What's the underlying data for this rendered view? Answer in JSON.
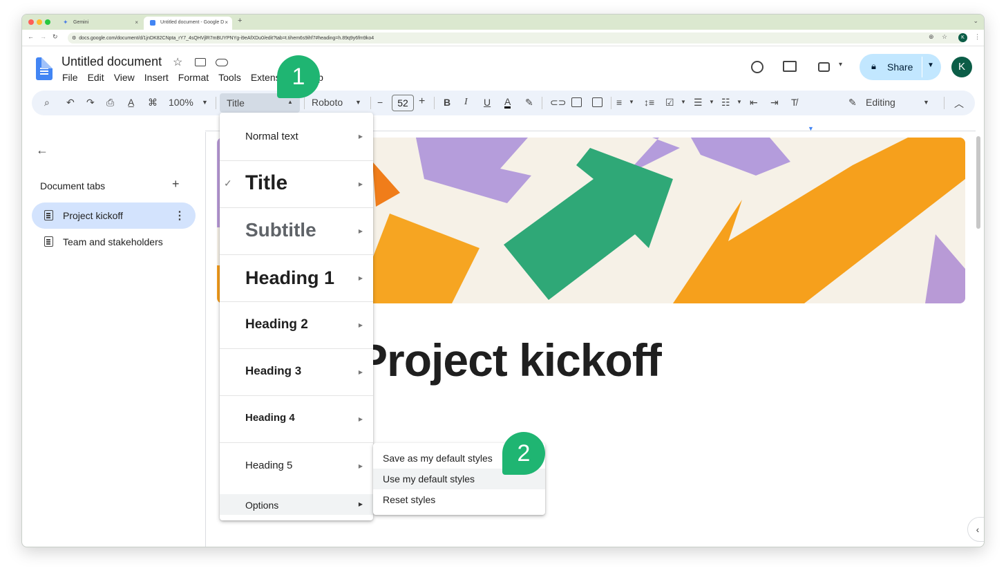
{
  "browser": {
    "tabs": [
      {
        "label": "Gemini"
      },
      {
        "label": "Untitled document - Google D"
      }
    ],
    "url": "docs.google.com/document/d/1jnDK82CNpta_rY7_4sQHVjlR7mBUYPNYg-i9eAfXDu0/edit?tab=t.tihem6s9ihf7#heading=h.89q9y6fm9ko4",
    "profile_initial": "K"
  },
  "docs": {
    "title": "Untitled document",
    "menu": [
      "File",
      "Edit",
      "View",
      "Insert",
      "Format",
      "Tools",
      "Extens",
      "lp"
    ],
    "share_label": "Share",
    "avatar_initial": "K"
  },
  "toolbar": {
    "zoom": "100%",
    "style": "Title",
    "font": "Roboto",
    "font_size": "52",
    "mode": "Editing"
  },
  "sidebar": {
    "title": "Document tabs",
    "items": [
      {
        "label": "Project kickoff",
        "active": true
      },
      {
        "label": "Team and stakeholders",
        "active": false
      }
    ]
  },
  "document": {
    "heading": "Project kickoff"
  },
  "style_menu": {
    "items": [
      {
        "label": "Normal text"
      },
      {
        "label": "Title",
        "checked": true
      },
      {
        "label": "Subtitle"
      },
      {
        "label": "Heading 1"
      },
      {
        "label": "Heading 2"
      },
      {
        "label": "Heading 3"
      },
      {
        "label": "Heading 4"
      },
      {
        "label": "Heading 5"
      }
    ],
    "options_label": "Options"
  },
  "options_submenu": {
    "items": [
      "Save as my default styles",
      "Use my default styles",
      "Reset styles"
    ]
  },
  "callouts": [
    "1",
    "2"
  ],
  "colors": {
    "accent_green": "#1fb572",
    "share_bg": "#c2e7ff",
    "toolbar_bg": "#edf2fa",
    "active_tab_bg": "#d3e3fd"
  }
}
